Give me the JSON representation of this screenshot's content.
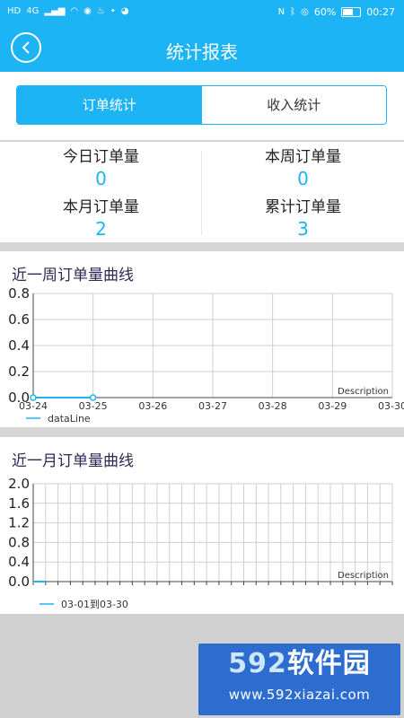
{
  "status_bar": {
    "left_icons": [
      "HD",
      "4G",
      "signal-icon",
      "wifi-icon",
      "eye-icon",
      "notification-icon",
      "dot-icon",
      "qq-icon"
    ],
    "battery": "60%",
    "time": "00:27"
  },
  "header": {
    "title": "统计报表"
  },
  "tabs": [
    {
      "label": "订单统计"
    },
    {
      "label": "收入统计"
    }
  ],
  "stats": {
    "today": {
      "label": "今日订单量",
      "value": "0"
    },
    "week": {
      "label": "本周订单量",
      "value": "0"
    },
    "month": {
      "label": "本月订单量",
      "value": "2"
    },
    "total": {
      "label": "累计订单量",
      "value": "3"
    }
  },
  "weekly_panel_title": "近一周订单量曲线",
  "monthly_panel_title": "近一月订单量曲线",
  "colors": {
    "accent": "#1db4f5",
    "grid": "#cfcfcf",
    "text": "#333333"
  },
  "chart_data": [
    {
      "type": "line",
      "title": "近一周订单量曲线",
      "categories": [
        "03-24",
        "03-25",
        "03-26",
        "03-27",
        "03-28",
        "03-29",
        "03-30"
      ],
      "series": [
        {
          "name": "dataLine",
          "values": [
            0,
            0
          ]
        }
      ],
      "ylim": [
        0,
        0.8
      ],
      "yticks": [
        "0.8",
        "0.6",
        "0.4",
        "0.2",
        "0.0"
      ],
      "description": "Description",
      "legend": "bottom-left",
      "grid": true
    },
    {
      "type": "line",
      "title": "近一月订单量曲线",
      "x_count": 30,
      "series": [
        {
          "name": "03-01到03-30",
          "values": [
            0,
            0
          ]
        }
      ],
      "ylim": [
        0,
        2.0
      ],
      "yticks": [
        "2.0",
        "1.6",
        "1.2",
        "0.8",
        "0.4",
        "0.0"
      ],
      "description": "Description",
      "legend": "bottom-left",
      "grid": true
    }
  ],
  "watermark": {
    "logo_digits": "592",
    "logo_text": "软件园",
    "url": "www.592xiazai.com"
  }
}
